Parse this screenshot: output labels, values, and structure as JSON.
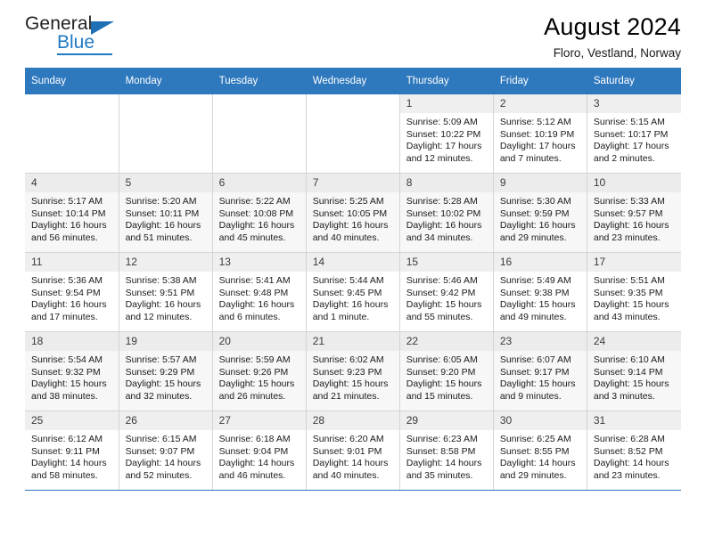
{
  "brand": {
    "name_top": "General",
    "name_bottom": "Blue",
    "accent_color": "#1f7ac4"
  },
  "header": {
    "title": "August 2024",
    "subtitle": "Floro, Vestland, Norway"
  },
  "theme": {
    "header_row_color": "#2e78bd",
    "daynum_band_color": "#efefef",
    "alt_row_color": "#f7f7f7"
  },
  "weekday_headers": [
    "Sunday",
    "Monday",
    "Tuesday",
    "Wednesday",
    "Thursday",
    "Friday",
    "Saturday"
  ],
  "weeks": [
    [
      {
        "day": "",
        "sunrise": "",
        "sunset": "",
        "daylight_line1": "",
        "daylight_line2": ""
      },
      {
        "day": "",
        "sunrise": "",
        "sunset": "",
        "daylight_line1": "",
        "daylight_line2": ""
      },
      {
        "day": "",
        "sunrise": "",
        "sunset": "",
        "daylight_line1": "",
        "daylight_line2": ""
      },
      {
        "day": "",
        "sunrise": "",
        "sunset": "",
        "daylight_line1": "",
        "daylight_line2": ""
      },
      {
        "day": "1",
        "sunrise": "Sunrise: 5:09 AM",
        "sunset": "Sunset: 10:22 PM",
        "daylight_line1": "Daylight: 17 hours",
        "daylight_line2": "and 12 minutes."
      },
      {
        "day": "2",
        "sunrise": "Sunrise: 5:12 AM",
        "sunset": "Sunset: 10:19 PM",
        "daylight_line1": "Daylight: 17 hours",
        "daylight_line2": "and 7 minutes."
      },
      {
        "day": "3",
        "sunrise": "Sunrise: 5:15 AM",
        "sunset": "Sunset: 10:17 PM",
        "daylight_line1": "Daylight: 17 hours",
        "daylight_line2": "and 2 minutes."
      }
    ],
    [
      {
        "day": "4",
        "sunrise": "Sunrise: 5:17 AM",
        "sunset": "Sunset: 10:14 PM",
        "daylight_line1": "Daylight: 16 hours",
        "daylight_line2": "and 56 minutes."
      },
      {
        "day": "5",
        "sunrise": "Sunrise: 5:20 AM",
        "sunset": "Sunset: 10:11 PM",
        "daylight_line1": "Daylight: 16 hours",
        "daylight_line2": "and 51 minutes."
      },
      {
        "day": "6",
        "sunrise": "Sunrise: 5:22 AM",
        "sunset": "Sunset: 10:08 PM",
        "daylight_line1": "Daylight: 16 hours",
        "daylight_line2": "and 45 minutes."
      },
      {
        "day": "7",
        "sunrise": "Sunrise: 5:25 AM",
        "sunset": "Sunset: 10:05 PM",
        "daylight_line1": "Daylight: 16 hours",
        "daylight_line2": "and 40 minutes."
      },
      {
        "day": "8",
        "sunrise": "Sunrise: 5:28 AM",
        "sunset": "Sunset: 10:02 PM",
        "daylight_line1": "Daylight: 16 hours",
        "daylight_line2": "and 34 minutes."
      },
      {
        "day": "9",
        "sunrise": "Sunrise: 5:30 AM",
        "sunset": "Sunset: 9:59 PM",
        "daylight_line1": "Daylight: 16 hours",
        "daylight_line2": "and 29 minutes."
      },
      {
        "day": "10",
        "sunrise": "Sunrise: 5:33 AM",
        "sunset": "Sunset: 9:57 PM",
        "daylight_line1": "Daylight: 16 hours",
        "daylight_line2": "and 23 minutes."
      }
    ],
    [
      {
        "day": "11",
        "sunrise": "Sunrise: 5:36 AM",
        "sunset": "Sunset: 9:54 PM",
        "daylight_line1": "Daylight: 16 hours",
        "daylight_line2": "and 17 minutes."
      },
      {
        "day": "12",
        "sunrise": "Sunrise: 5:38 AM",
        "sunset": "Sunset: 9:51 PM",
        "daylight_line1": "Daylight: 16 hours",
        "daylight_line2": "and 12 minutes."
      },
      {
        "day": "13",
        "sunrise": "Sunrise: 5:41 AM",
        "sunset": "Sunset: 9:48 PM",
        "daylight_line1": "Daylight: 16 hours",
        "daylight_line2": "and 6 minutes."
      },
      {
        "day": "14",
        "sunrise": "Sunrise: 5:44 AM",
        "sunset": "Sunset: 9:45 PM",
        "daylight_line1": "Daylight: 16 hours",
        "daylight_line2": "and 1 minute."
      },
      {
        "day": "15",
        "sunrise": "Sunrise: 5:46 AM",
        "sunset": "Sunset: 9:42 PM",
        "daylight_line1": "Daylight: 15 hours",
        "daylight_line2": "and 55 minutes."
      },
      {
        "day": "16",
        "sunrise": "Sunrise: 5:49 AM",
        "sunset": "Sunset: 9:38 PM",
        "daylight_line1": "Daylight: 15 hours",
        "daylight_line2": "and 49 minutes."
      },
      {
        "day": "17",
        "sunrise": "Sunrise: 5:51 AM",
        "sunset": "Sunset: 9:35 PM",
        "daylight_line1": "Daylight: 15 hours",
        "daylight_line2": "and 43 minutes."
      }
    ],
    [
      {
        "day": "18",
        "sunrise": "Sunrise: 5:54 AM",
        "sunset": "Sunset: 9:32 PM",
        "daylight_line1": "Daylight: 15 hours",
        "daylight_line2": "and 38 minutes."
      },
      {
        "day": "19",
        "sunrise": "Sunrise: 5:57 AM",
        "sunset": "Sunset: 9:29 PM",
        "daylight_line1": "Daylight: 15 hours",
        "daylight_line2": "and 32 minutes."
      },
      {
        "day": "20",
        "sunrise": "Sunrise: 5:59 AM",
        "sunset": "Sunset: 9:26 PM",
        "daylight_line1": "Daylight: 15 hours",
        "daylight_line2": "and 26 minutes."
      },
      {
        "day": "21",
        "sunrise": "Sunrise: 6:02 AM",
        "sunset": "Sunset: 9:23 PM",
        "daylight_line1": "Daylight: 15 hours",
        "daylight_line2": "and 21 minutes."
      },
      {
        "day": "22",
        "sunrise": "Sunrise: 6:05 AM",
        "sunset": "Sunset: 9:20 PM",
        "daylight_line1": "Daylight: 15 hours",
        "daylight_line2": "and 15 minutes."
      },
      {
        "day": "23",
        "sunrise": "Sunrise: 6:07 AM",
        "sunset": "Sunset: 9:17 PM",
        "daylight_line1": "Daylight: 15 hours",
        "daylight_line2": "and 9 minutes."
      },
      {
        "day": "24",
        "sunrise": "Sunrise: 6:10 AM",
        "sunset": "Sunset: 9:14 PM",
        "daylight_line1": "Daylight: 15 hours",
        "daylight_line2": "and 3 minutes."
      }
    ],
    [
      {
        "day": "25",
        "sunrise": "Sunrise: 6:12 AM",
        "sunset": "Sunset: 9:11 PM",
        "daylight_line1": "Daylight: 14 hours",
        "daylight_line2": "and 58 minutes."
      },
      {
        "day": "26",
        "sunrise": "Sunrise: 6:15 AM",
        "sunset": "Sunset: 9:07 PM",
        "daylight_line1": "Daylight: 14 hours",
        "daylight_line2": "and 52 minutes."
      },
      {
        "day": "27",
        "sunrise": "Sunrise: 6:18 AM",
        "sunset": "Sunset: 9:04 PM",
        "daylight_line1": "Daylight: 14 hours",
        "daylight_line2": "and 46 minutes."
      },
      {
        "day": "28",
        "sunrise": "Sunrise: 6:20 AM",
        "sunset": "Sunset: 9:01 PM",
        "daylight_line1": "Daylight: 14 hours",
        "daylight_line2": "and 40 minutes."
      },
      {
        "day": "29",
        "sunrise": "Sunrise: 6:23 AM",
        "sunset": "Sunset: 8:58 PM",
        "daylight_line1": "Daylight: 14 hours",
        "daylight_line2": "and 35 minutes."
      },
      {
        "day": "30",
        "sunrise": "Sunrise: 6:25 AM",
        "sunset": "Sunset: 8:55 PM",
        "daylight_line1": "Daylight: 14 hours",
        "daylight_line2": "and 29 minutes."
      },
      {
        "day": "31",
        "sunrise": "Sunrise: 6:28 AM",
        "sunset": "Sunset: 8:52 PM",
        "daylight_line1": "Daylight: 14 hours",
        "daylight_line2": "and 23 minutes."
      }
    ]
  ]
}
